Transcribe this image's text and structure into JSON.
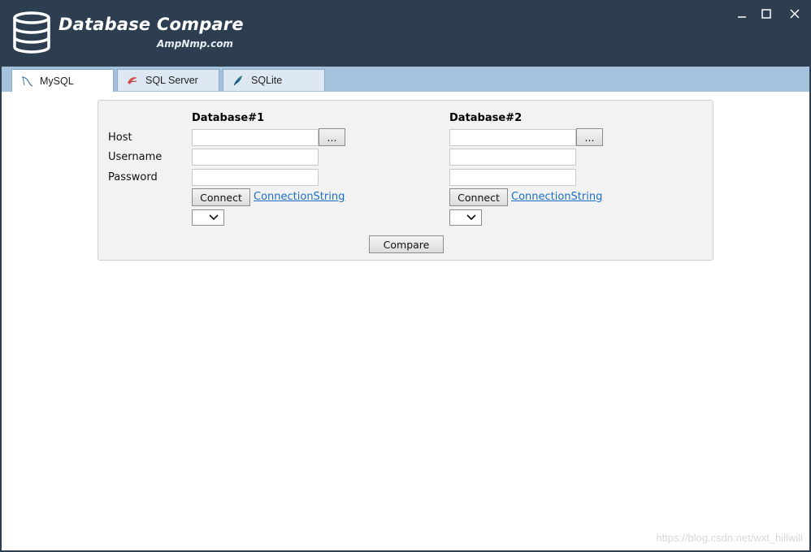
{
  "app": {
    "title": "Database Compare",
    "subtitle": "AmpNmp.com"
  },
  "window_controls": {
    "icons": [
      "minimize-icon",
      "maximize-icon",
      "close-icon"
    ]
  },
  "tabs": [
    {
      "label": "MySQL",
      "icon": "mysql-dolphin-icon",
      "active": true
    },
    {
      "label": "SQL Server",
      "icon": "sql-server-icon",
      "active": false
    },
    {
      "label": "SQLite",
      "icon": "sqlite-feather-icon",
      "active": false
    }
  ],
  "form": {
    "labels": {
      "host": "Host",
      "username": "Username",
      "password": "Password"
    },
    "db1": {
      "header": "Database#1",
      "host": "",
      "username": "",
      "password": "",
      "browse_label": "...",
      "connect_label": "Connect",
      "connection_string_label": "ConnectionString",
      "selected_database": ""
    },
    "db2": {
      "header": "Database#2",
      "host": "",
      "username": "",
      "password": "",
      "browse_label": "...",
      "connect_label": "Connect",
      "connection_string_label": "ConnectionString",
      "selected_database": ""
    },
    "compare_label": "Compare"
  },
  "watermark": "https://blog.csdn.net/wxt_hillwill",
  "colors": {
    "titlebar": "#2c3e50",
    "tabbar": "#a4c2dc",
    "panel": "#f2f2f2",
    "link": "#1a6fc4"
  }
}
